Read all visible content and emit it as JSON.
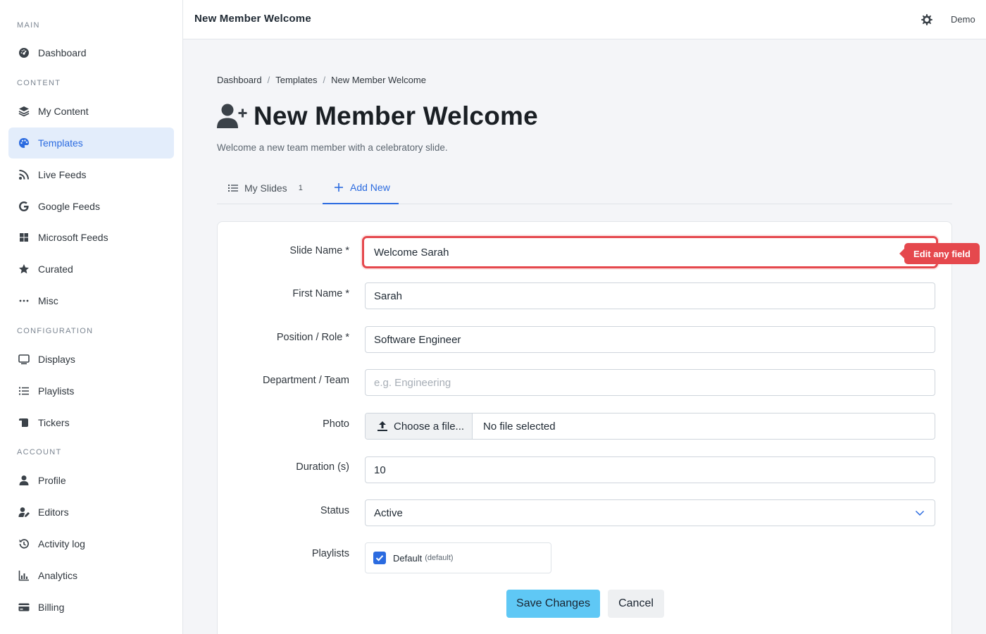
{
  "app": {
    "header_title": "New Member Welcome",
    "user_name": "Demo"
  },
  "sidebar": {
    "sections": [
      {
        "title": "MAIN"
      },
      {
        "title": "CONTENT"
      },
      {
        "title": "CONFIGURATION"
      },
      {
        "title": "ACCOUNT"
      }
    ],
    "items": [
      {
        "label": "Dashboard",
        "icon": "gauge-icon"
      },
      {
        "label": "My Content",
        "icon": "layers-icon"
      },
      {
        "label": "Templates",
        "icon": "palette-icon",
        "active": true
      },
      {
        "label": "Live Feeds",
        "icon": "rss-icon"
      },
      {
        "label": "Google Feeds",
        "icon": "google-icon"
      },
      {
        "label": "Microsoft Feeds",
        "icon": "windows-icon"
      },
      {
        "label": "Curated",
        "icon": "star-icon"
      },
      {
        "label": "Misc",
        "icon": "ellipsis-icon"
      },
      {
        "label": "Displays",
        "icon": "monitor-icon"
      },
      {
        "label": "Playlists",
        "icon": "list-icon"
      },
      {
        "label": "Tickers",
        "icon": "scroll-icon"
      },
      {
        "label": "Profile",
        "icon": "user-icon"
      },
      {
        "label": "Editors",
        "icon": "user-edit-icon"
      },
      {
        "label": "Activity log",
        "icon": "history-icon"
      },
      {
        "label": "Analytics",
        "icon": "chart-icon"
      },
      {
        "label": "Billing",
        "icon": "credit-card-icon"
      }
    ]
  },
  "breadcrumb": [
    "Dashboard",
    "Templates",
    "New Member Welcome"
  ],
  "page": {
    "title": "New Member Welcome",
    "subtitle": "Welcome a new team member with a celebratory slide."
  },
  "tabs": [
    {
      "label": "My Slides",
      "count": "1"
    },
    {
      "label": "Add New",
      "active": true
    }
  ],
  "form": {
    "slide_name": {
      "label": "Slide Name *",
      "value": "Welcome Sarah"
    },
    "first_name": {
      "label": "First Name *",
      "value": "Sarah"
    },
    "position": {
      "label": "Position / Role *",
      "value": "Software Engineer"
    },
    "department": {
      "label": "Department / Team",
      "value": "",
      "placeholder": "e.g. Engineering"
    },
    "photo": {
      "label": "Photo",
      "button": "Choose a file...",
      "file": "No file selected"
    },
    "duration": {
      "label": "Duration (s)",
      "value": "10"
    },
    "status": {
      "label": "Status",
      "value": "Active"
    },
    "playlists": {
      "label": "Playlists",
      "name": "Default",
      "tag": "(default)",
      "checked": true
    },
    "save_label": "Save Changes",
    "cancel_label": "Cancel"
  },
  "tooltip": "Edit any field",
  "colors": {
    "accent": "#2b6be0",
    "highlight": "#e5484d",
    "save_button": "#5fc8f5"
  }
}
